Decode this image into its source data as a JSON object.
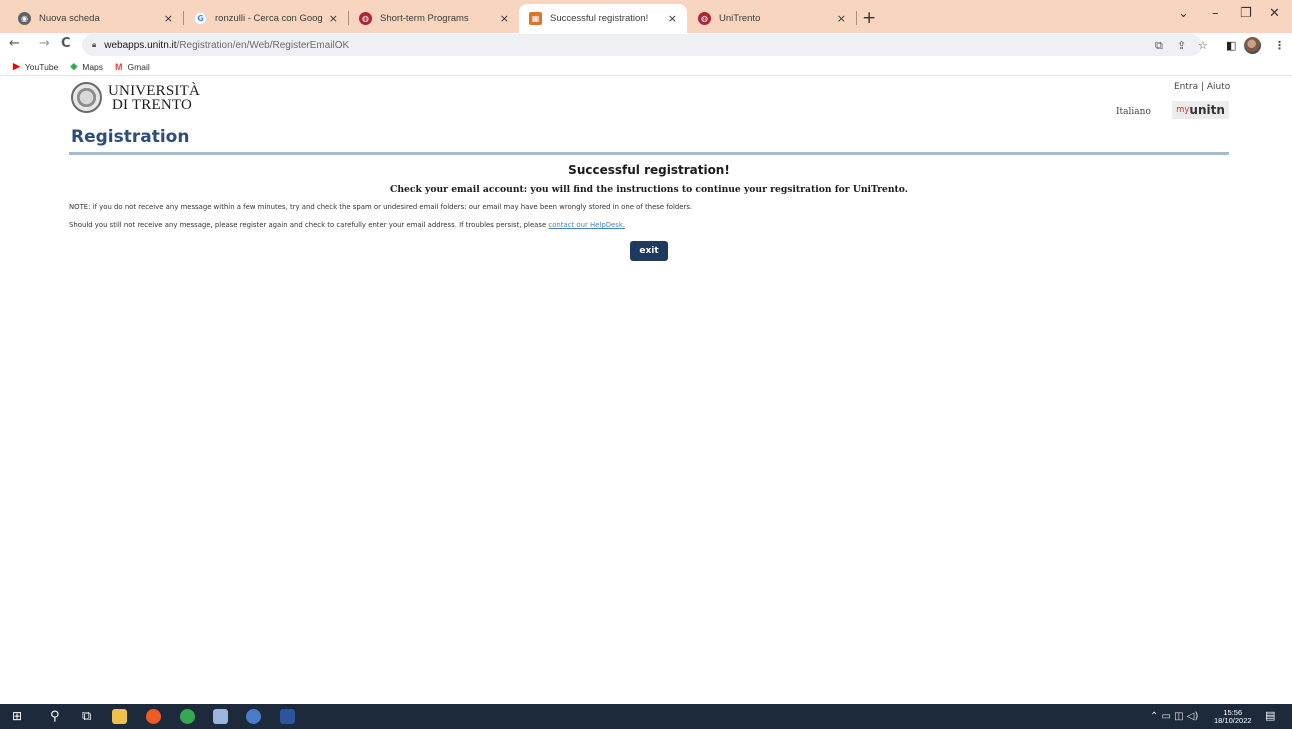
{
  "browser": {
    "tabs": [
      {
        "label": "Nuova scheda",
        "active": false
      },
      {
        "label": "ronzulli - Cerca con Google",
        "active": false
      },
      {
        "label": "Short-term Programs",
        "active": false
      },
      {
        "label": "Successful registration!",
        "active": true
      },
      {
        "label": "UniTrento",
        "active": false
      }
    ],
    "tab_close": "×",
    "new_tab": "+",
    "window_controls": {
      "dropdown": "⌄",
      "minimize": "–",
      "maximize": "❐",
      "close": "✕"
    },
    "url_host": "webapps.unitn.it",
    "url_path": "/Registration/en/Web/RegisterEmailOK",
    "nav": {
      "back": "←",
      "forward": "→",
      "reload": "C"
    }
  },
  "bookmarks": [
    {
      "label": "YouTube",
      "icon": "youtube-icon"
    },
    {
      "label": "Maps",
      "icon": "maps-icon"
    },
    {
      "label": "Gmail",
      "icon": "gmail-icon"
    }
  ],
  "site": {
    "logo_line1": "UNIVERSITÀ",
    "logo_line2": "DI TRENTO",
    "top_links": "Entra | Aiuto",
    "language": "Italiano",
    "myunitn_prefix": "my",
    "myunitn_brand": "unitn",
    "page_title": "Registration"
  },
  "main": {
    "heading": "Successful registration!",
    "subheading": "Check your email account: you will find the instructions to continue your regsitration for UniTrento.",
    "note": "NOTE: if you do not receive any message within a few minutes, try and check the spam or undesired email folders: our email may have been wrongly stored in one of these folders.",
    "note2_text": "Should you still not receive any message, please register again and check to carefully enter your email address. If troubles persist, please ",
    "helpdesk_link": "contact our HelpDesk.",
    "exit_button": "exit"
  },
  "taskbar": {
    "time": "15:56",
    "date": "18/10/2022"
  },
  "colors": {
    "tabstrip": "#f7d5bf",
    "title": "#2c4e78",
    "button": "#1e3a5f",
    "link": "#4b7fbd",
    "taskbar": "#1c2a3b"
  }
}
